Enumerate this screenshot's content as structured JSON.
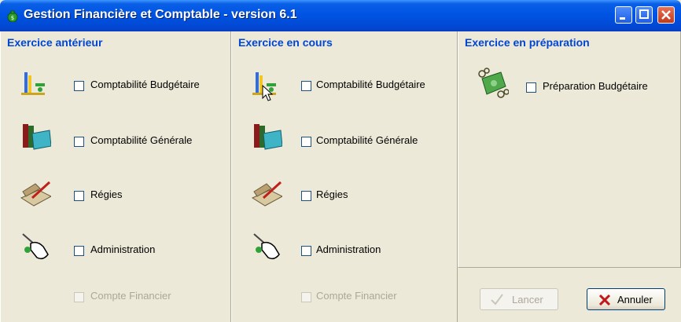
{
  "window": {
    "title": "Gestion Financière et Comptable - version 6.1",
    "app_icon": "money-bag-icon",
    "accent_color": "#0054e3"
  },
  "sections": [
    {
      "header": "Exercice antérieur",
      "items": [
        {
          "label": "Comptabilité Budgétaire",
          "icon": "budget-scale-icon",
          "checked": false
        },
        {
          "label": "Comptabilité Générale",
          "icon": "ledger-books-icon",
          "checked": false
        },
        {
          "label": "Régies",
          "icon": "quill-book-icon",
          "checked": false
        },
        {
          "label": "Administration",
          "icon": "hand-pointer-icon",
          "checked": false
        }
      ],
      "disabled_item": {
        "label": "Compte Financier",
        "checked": false
      }
    },
    {
      "header": "Exercice en cours",
      "items": [
        {
          "label": "Comptabilité Budgétaire",
          "icon": "budget-scale-icon",
          "checked": false
        },
        {
          "label": "Comptabilité Générale",
          "icon": "ledger-books-icon",
          "checked": false
        },
        {
          "label": "Régies",
          "icon": "quill-book-icon",
          "checked": false
        },
        {
          "label": "Administration",
          "icon": "hand-pointer-icon",
          "checked": false
        }
      ],
      "disabled_item": {
        "label": "Compte Financier",
        "checked": false
      }
    },
    {
      "header": "Exercice en préparation",
      "items": [
        {
          "label": "Préparation Budgétaire",
          "icon": "banknotes-coins-icon",
          "checked": false
        }
      ]
    }
  ],
  "buttons": {
    "launch": "Lancer",
    "cancel": "Annuler"
  }
}
